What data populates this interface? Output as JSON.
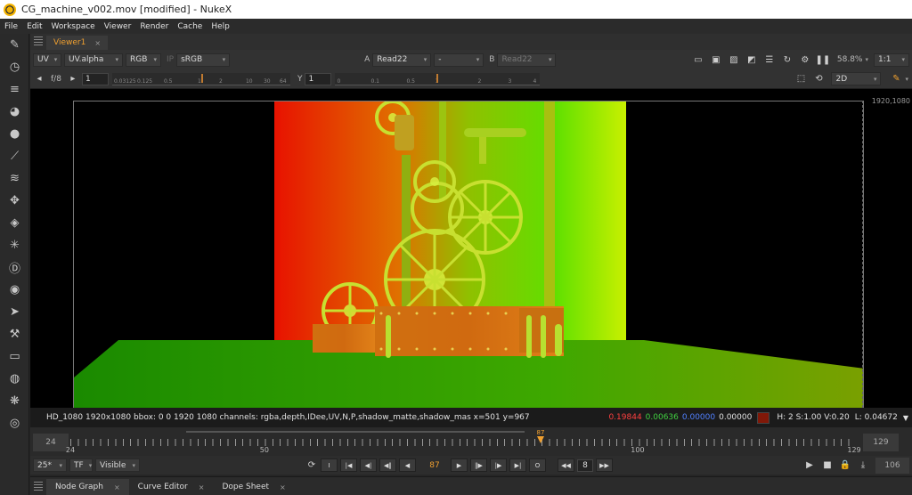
{
  "window": {
    "title": "CG_machine_v002.mov [modified] - NukeX"
  },
  "menu": [
    "File",
    "Edit",
    "Workspace",
    "Viewer",
    "Render",
    "Cache",
    "Help"
  ],
  "left_tools": [
    "pen-icon",
    "clock-icon",
    "channel-icon",
    "color-icon",
    "circle-icon",
    "filter-icon",
    "keyer-icon",
    "transform-icon",
    "3d-icon",
    "particle-icon",
    "deep-icon",
    "views-icon",
    "metadata-icon",
    "toolset-icon",
    "other-icon",
    "furnace-icon",
    "ofx-icon",
    "cara-icon"
  ],
  "viewer_tab": {
    "label": "Viewer1",
    "close": "×"
  },
  "toolbar1": {
    "layer": "UV",
    "channel": "UV.alpha",
    "display": "RGB",
    "ip": "IP",
    "lut": "sRGB",
    "a_label": "A",
    "a_input": "Read22",
    "op": "-",
    "b_label": "B",
    "b_input": "Read22",
    "zoom": "58.8%",
    "ratio": "1:1"
  },
  "toolbar2": {
    "fstop": "f/8",
    "gain_value": "1",
    "y_label": "Y",
    "gamma_value": "1",
    "gain_ticks": [
      "0.03125",
      "0.125",
      "0.5",
      "1",
      "2",
      "10",
      "30",
      "64"
    ],
    "gamma_ticks": [
      "0",
      "0.1",
      "0.5",
      "1",
      "2",
      "3",
      "4"
    ],
    "view_mode": "2D"
  },
  "canvas": {
    "resolution_label": "1920,1080"
  },
  "infobar": {
    "format": "HD_1080 1920x1080  bbox: 0 0 1920 1080 channels: rgba,depth,IDee,UV,N,P,shadow_matte,shadow_mas  x=501 y=967",
    "r": "0.19844",
    "g": "0.00636",
    "b": "0.00000",
    "a": "0.00000",
    "hsv": "H:  2 S:1.00 V:0.20",
    "lum": "L: 0.04672"
  },
  "timeline": {
    "in_frame": "24",
    "out_frame": "129",
    "current": "87",
    "labels": [
      "24",
      "50",
      "100",
      "129"
    ],
    "start": 24,
    "end": 129
  },
  "playbar": {
    "fps": "25*",
    "tf": "TF",
    "visible": "Visible",
    "current_frame": "87",
    "step": "8",
    "end_frame": "106"
  },
  "bottom_tabs": [
    {
      "label": "Node Graph"
    },
    {
      "label": "Curve Editor"
    },
    {
      "label": "Dope Sheet"
    }
  ]
}
